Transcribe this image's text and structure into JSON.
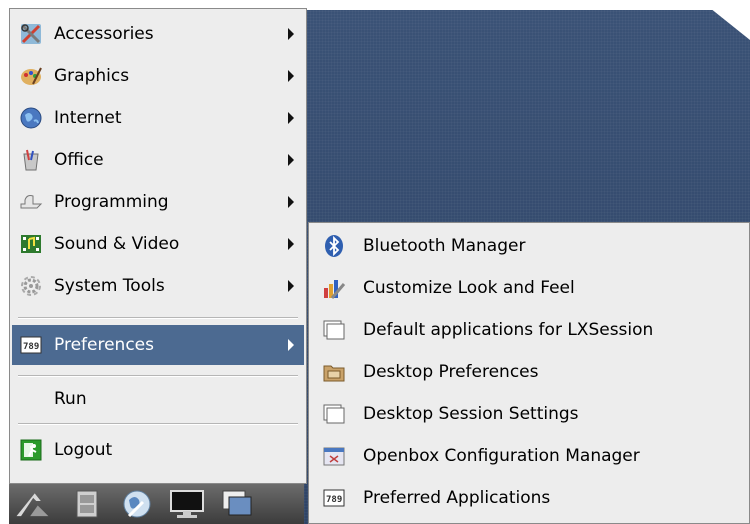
{
  "menu": {
    "items": [
      {
        "label": "Accessories",
        "icon": "accessories-icon"
      },
      {
        "label": "Graphics",
        "icon": "graphics-icon"
      },
      {
        "label": "Internet",
        "icon": "internet-icon"
      },
      {
        "label": "Office",
        "icon": "office-icon"
      },
      {
        "label": "Programming",
        "icon": "programming-icon"
      },
      {
        "label": "Sound & Video",
        "icon": "sound-video-icon"
      },
      {
        "label": "System Tools",
        "icon": "system-tools-icon"
      },
      {
        "label": "Preferences",
        "icon": "preferences-icon"
      }
    ],
    "run": "Run",
    "logout": "Logout",
    "active_item": "Preferences"
  },
  "submenu": {
    "items": [
      {
        "label": "Bluetooth Manager",
        "icon": "bluetooth-icon"
      },
      {
        "label": "Customize Look and Feel",
        "icon": "appearance-icon"
      },
      {
        "label": "Default applications for LXSession",
        "icon": "window-icon"
      },
      {
        "label": "Desktop Preferences",
        "icon": "folder-icon"
      },
      {
        "label": "Desktop Session Settings",
        "icon": "window-icon"
      },
      {
        "label": "Openbox Configuration Manager",
        "icon": "openbox-icon"
      },
      {
        "label": "Preferred Applications",
        "icon": "preferences-icon"
      }
    ]
  },
  "taskbar": {
    "icons": [
      "lxde-logo-icon",
      "file-manager-icon",
      "web-browser-icon",
      "terminal-icon",
      "desktop-icon"
    ]
  },
  "colors": {
    "highlight": "#4c6a91",
    "menu_bg": "#ededed",
    "desktop": "#33496c"
  }
}
